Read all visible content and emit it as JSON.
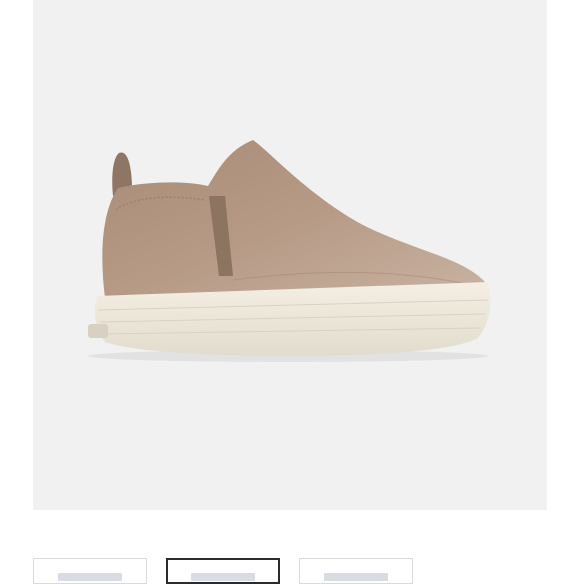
{
  "product": {
    "image_icon": "suede-slip-on-platform-sneaker",
    "colors": {
      "background": "#f1f1f1",
      "suede": "#b29580",
      "sole": "#ece6d7"
    }
  },
  "gallery": {
    "thumbnail_count": 3,
    "selected_index": 1
  }
}
